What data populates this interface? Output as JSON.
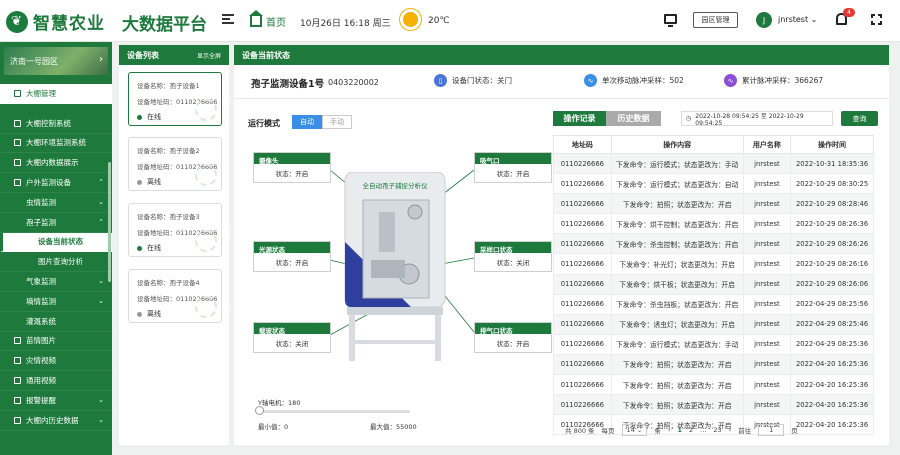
{
  "header": {
    "logo": "智慧农业",
    "platform": "大数据平台",
    "home": "首页",
    "datetime": "10月26日  16:18  周三",
    "temperature": "20℃",
    "park_button": "园区管理",
    "avatar_letter": "J",
    "username": "jnrstest",
    "notifications": "4"
  },
  "sidebar": {
    "park": "济南一号园区",
    "items": [
      {
        "label": "大棚管理"
      },
      {
        "label": "大棚控制系统"
      },
      {
        "label": "大棚环境监测系统"
      },
      {
        "label": "大棚内数据展示"
      },
      {
        "label": "户外监测设备"
      },
      {
        "label": "虫情监测"
      },
      {
        "label": "孢子监测"
      },
      {
        "label": "设备当前状态"
      },
      {
        "label": "图片查询分析"
      },
      {
        "label": "气象监测"
      },
      {
        "label": "墒情监测"
      },
      {
        "label": "灌溉系统"
      },
      {
        "label": "苗情图片"
      },
      {
        "label": "灾情视频"
      },
      {
        "label": "通用视频"
      },
      {
        "label": "报警提醒"
      },
      {
        "label": "大棚内历史数据"
      }
    ]
  },
  "device_list": {
    "title": "设备列表",
    "show_all": "显示全屏",
    "devices": [
      {
        "name": "设备名称：孢子设备1",
        "addr": "设备地址码：0110226666",
        "status": "在线"
      },
      {
        "name": "设备名称：孢子设备2",
        "addr": "设备地址码：0110226666",
        "status": "离线"
      },
      {
        "name": "设备名称：孢子设备3",
        "addr": "设备地址码：0110226666",
        "status": "在线"
      },
      {
        "name": "设备名称：孢子设备4",
        "addr": "设备地址码：0110226666",
        "status": "离线"
      }
    ]
  },
  "main": {
    "title": "设备当前状态",
    "device_name": "孢子监测设备1号",
    "device_code": "0403220002",
    "door_status": "设备门状态：关门",
    "single_pulse": "单次移动脉冲采样：502",
    "total_pulse": "累计脉冲采样：366267",
    "mode_label": "运行模式",
    "mode_auto": "自动",
    "mode_manual": "手动",
    "machine_title": "全自动孢子捕捉分析仪",
    "labels": [
      {
        "title": "摄像头",
        "value": "状态：开启"
      },
      {
        "title": "光源状态",
        "value": "状态：开启"
      },
      {
        "title": "载玻状态",
        "value": "状态：关闭"
      },
      {
        "title": "吸气口",
        "value": "状态：开启"
      },
      {
        "title": "采样口状态",
        "value": "状态：关闭"
      },
      {
        "title": "排气口状态",
        "value": "状态：开启"
      }
    ],
    "slider": {
      "label": "Y轴电机：180",
      "min": "最小值：0",
      "max": "最大值：55000",
      "value": 180,
      "range_max": 55000
    },
    "tab_records": "操作记录",
    "tab_history": "历史数据",
    "date_range": "2022-10-28 09:54:25   至   2022-10-29 09:54:25",
    "query": "查询",
    "table": {
      "headers": [
        "地址码",
        "操作内容",
        "用户名称",
        "操作时间"
      ],
      "rows": [
        [
          "0110226666",
          "下发命令：运行模式；状态更改为：手动",
          "jnrstest",
          "2022-10-31   18:35:36"
        ],
        [
          "0110226666",
          "下发命令：运行模式；状态更改为：自动",
          "jnrstest",
          "2022-10-29   08:30:25"
        ],
        [
          "0110226666",
          "下发命令：拍照；状态更改为：开启",
          "jnrstest",
          "2022-10-29   08:28:46"
        ],
        [
          "0110226666",
          "下发命令：烘干控制；状态更改为：开启",
          "jnrstest",
          "2022-10-29   08:26:36"
        ],
        [
          "0110226666",
          "下发命令：杀虫控制；状态更改为：开启",
          "jnrstest",
          "2022-10-29   08:26:26"
        ],
        [
          "0110226666",
          "下发命令：补光灯；状态更改为：开启",
          "jnrstest",
          "2022-10-29   08:26:16"
        ],
        [
          "0110226666",
          "下发命令：烘干板；状态更改为：开启",
          "jnrstest",
          "2022-10-29   08:26:06"
        ],
        [
          "0110226666",
          "下发命令：杀虫挡板；状态更改为：开启",
          "jnrstest",
          "2022-04-29   08:25:56"
        ],
        [
          "0110226666",
          "下发命令：诱虫灯；状态更改为：开启",
          "jnrstest",
          "2022-04-29   08:25:46"
        ],
        [
          "0110226666",
          "下发命令：运行模式；状态更改为：手动",
          "jnrstest",
          "2022-04-29   08:25:36"
        ],
        [
          "0110226666",
          "下发命令：拍照；状态更改为：开启",
          "jnrstest",
          "2022-04-20   16:25:36"
        ],
        [
          "0110226666",
          "下发命令：拍照；状态更改为：开启",
          "jnrstest",
          "2022-04-20   16:25:36"
        ],
        [
          "0110226666",
          "下发命令：拍照；状态更改为：开启",
          "jnrstest",
          "2022-04-20   16:25:36"
        ],
        [
          "0110226666",
          "下发命令：拍照；状态更改为：开启",
          "jnrstest",
          "2022-04-20   16:25:36"
        ]
      ]
    },
    "pager": {
      "total": "共 800 条",
      "per_page_label": "每页",
      "per_page": "14",
      "unit": "条",
      "prev": "‹",
      "p1": "1",
      "p2": "2",
      "ellipsis": "...",
      "last": "23",
      "next": "›",
      "goto": "前往",
      "goto_val": "1",
      "page": "页"
    }
  },
  "colors": {
    "primary": "#1d7a3c",
    "blue": "#3a8ee6",
    "alert": "#e53935"
  }
}
